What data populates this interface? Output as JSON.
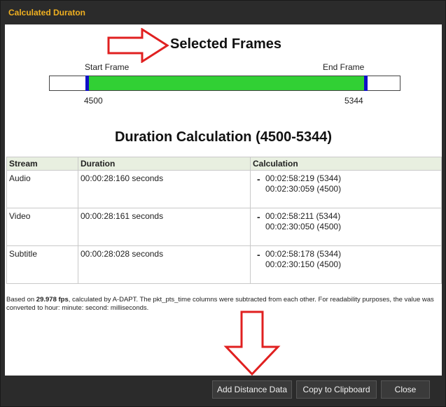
{
  "window": {
    "title": "Calculated Duraton"
  },
  "selection": {
    "heading": "Selected Frames",
    "start_label": "Start Frame",
    "end_label": "End Frame",
    "start_frame": "4500",
    "end_frame": "5344",
    "fill_color": "#31d034",
    "marker_color": "#1010c8"
  },
  "calc_heading": "Duration Calculation (4500-5344)",
  "table": {
    "headers": {
      "stream": "Stream",
      "duration": "Duration",
      "calculation": "Calculation"
    },
    "rows": [
      {
        "stream": "Audio",
        "duration": "00:00:28:160 seconds",
        "minus": "-",
        "calc1": "00:02:58:219 (5344)",
        "calc2": "00:02:30:059 (4500)"
      },
      {
        "stream": "Video",
        "duration": "00:00:28:161 seconds",
        "minus": "-",
        "calc1": "00:02:58:211 (5344)",
        "calc2": "00:02:30:050 (4500)"
      },
      {
        "stream": "Subtitle",
        "duration": "00:00:28:028 seconds",
        "minus": "-",
        "calc1": "00:02:58:178 (5344)",
        "calc2": "00:02:30:150 (4500)"
      }
    ]
  },
  "footnote": {
    "prefix": "Based on ",
    "fps": "29.978 fps",
    "suffix": ", calculated by A-DAPT. The pkt_pts_time columns were subtracted from each other. For readability purposes, the value was converted to hour: minute: second: milliseconds."
  },
  "buttons": {
    "add_distance": "Add Distance Data",
    "copy": "Copy to Clipboard",
    "close": "Close"
  },
  "annotation_color": "#e02020",
  "title_color": "#f0b020"
}
